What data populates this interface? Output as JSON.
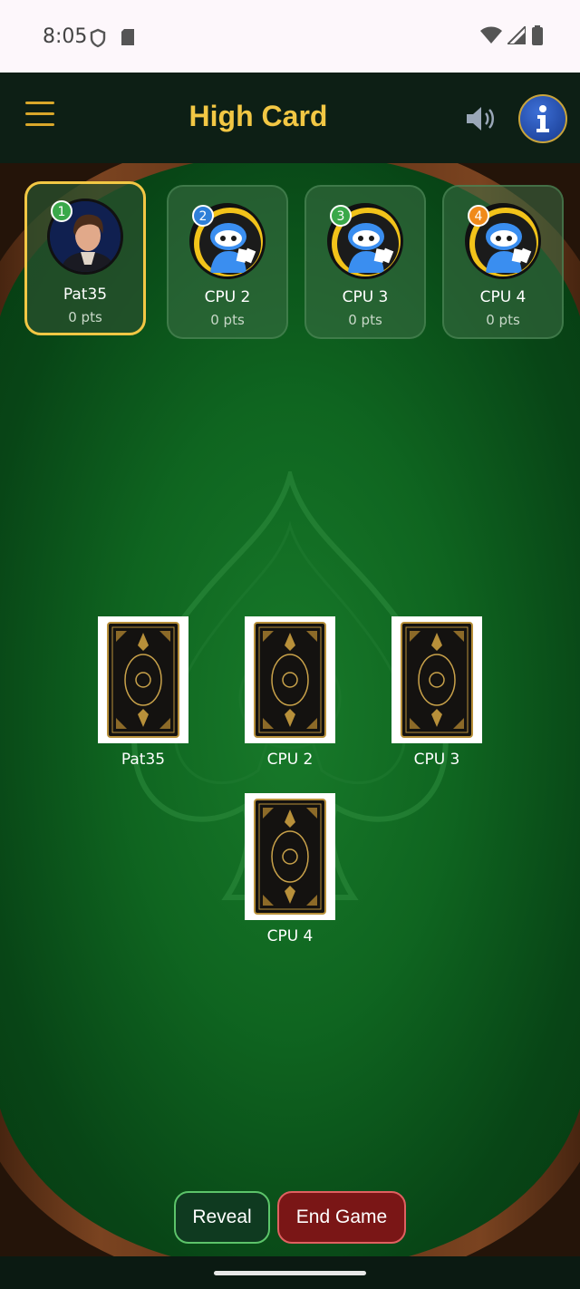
{
  "status_bar": {
    "time": "8:05"
  },
  "header": {
    "title": "High Card"
  },
  "players": [
    {
      "rank": "1",
      "name": "Pat35",
      "score": "0 pts",
      "badge_color": "#3aa84a",
      "active": true
    },
    {
      "rank": "2",
      "name": "CPU 2",
      "score": "0 pts",
      "badge_color": "#2f7fd8",
      "active": false
    },
    {
      "rank": "3",
      "name": "CPU 3",
      "score": "0 pts",
      "badge_color": "#3aa84a",
      "active": false
    },
    {
      "rank": "4",
      "name": "CPU 4",
      "score": "0 pts",
      "badge_color": "#f08a1a",
      "active": false
    }
  ],
  "table": {
    "played_cards": [
      {
        "label": "Pat35"
      },
      {
        "label": "CPU 2"
      },
      {
        "label": "CPU 3"
      },
      {
        "label": "CPU 4"
      }
    ]
  },
  "actions": {
    "reveal_label": "Reveal",
    "end_game_label": "End Game"
  },
  "colors": {
    "accent": "#f2c744",
    "felt": "#0f6520",
    "reveal_border": "#5cc46a",
    "end_game_bg": "#7a1616"
  }
}
